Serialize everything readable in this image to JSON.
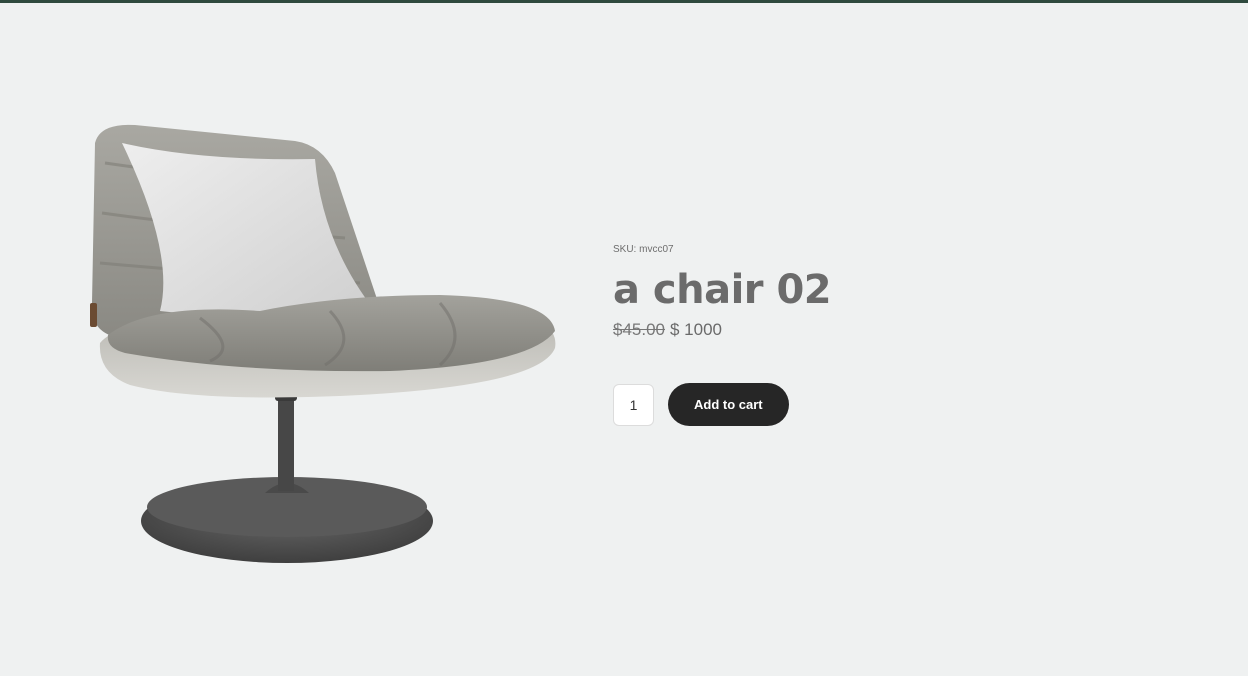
{
  "product": {
    "image_alt": "chair",
    "sku_label": "SKU: mvcc07",
    "title": "a chair 02",
    "regular_price": "$45.00",
    "sale_price": "$ 1000",
    "quantity": "1",
    "add_to_cart_label": "Add to cart"
  },
  "colors": {
    "background": "#eff1f1",
    "top_border": "#2f4a3e",
    "button": "#262626",
    "title": "#6b6b6b"
  }
}
